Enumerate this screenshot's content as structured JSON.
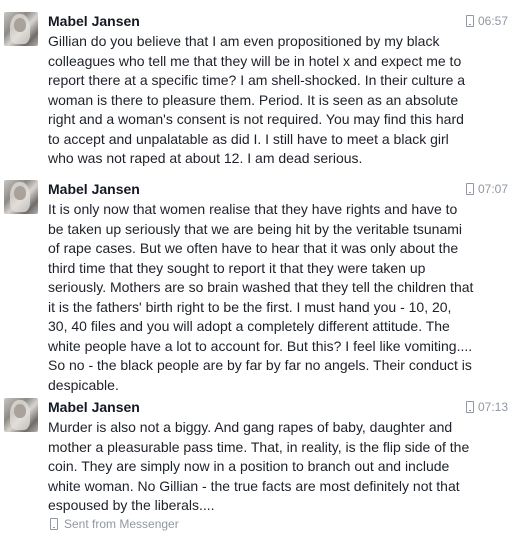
{
  "messages": [
    {
      "sender": "Mabel Jansen",
      "time": "06:57",
      "text": "Gillian do you believe that I am even propositioned by my black\ncolleagues who tell me that they will be in hotel x and expect me to\nreport there at a specific time? I am shell-shocked. In their culture a\nwoman is there to pleasure them. Period. It is seen as an absolute\nright and a woman's consent is not required. You may find this hard\nto accept and unpalatable as did I. I still have to meet a black girl\nwho was not raped at about 12. I am dead serious."
    },
    {
      "sender": "Mabel Jansen",
      "time": "07:07",
      "text": "It is only now that women realise that they have rights and have to\nbe taken up seriously that we are being hit by the veritable tsunami\nof rape cases. But we often have to hear that it was only about the\nthird time that they sought to report it that they were taken up\nseriously. Mothers are so brain washed that they tell the children that\nit is the fathers' birth right to be the first. I must hand you - 10, 20,\n30, 40 files and you will adopt a completely different attitude. The\nwhite people have a lot to account for. But this? I feel like vomiting....\nSo no - the black people are by far by far no angels. Their conduct is\ndespicable."
    },
    {
      "sender": "Mabel Jansen",
      "time": "07:13",
      "text": "Murder is also not a biggy. And gang rapes of baby, daughter and\nmother a pleasurable pass time. That, in reality, is the flip side of the\ncoin. They are simply now in a position to branch out and include\nwhite woman. No Gillian - the true facts are most definitely not that\nespoused by the liberals...."
    }
  ],
  "footer": {
    "sent_from": "Sent from Messenger"
  },
  "icons": {
    "timestamp": "mobile-phone-icon",
    "sent_from": "mobile-phone-icon"
  },
  "colors": {
    "name": "#141823",
    "text": "#1d2129",
    "meta": "#9197a3"
  }
}
